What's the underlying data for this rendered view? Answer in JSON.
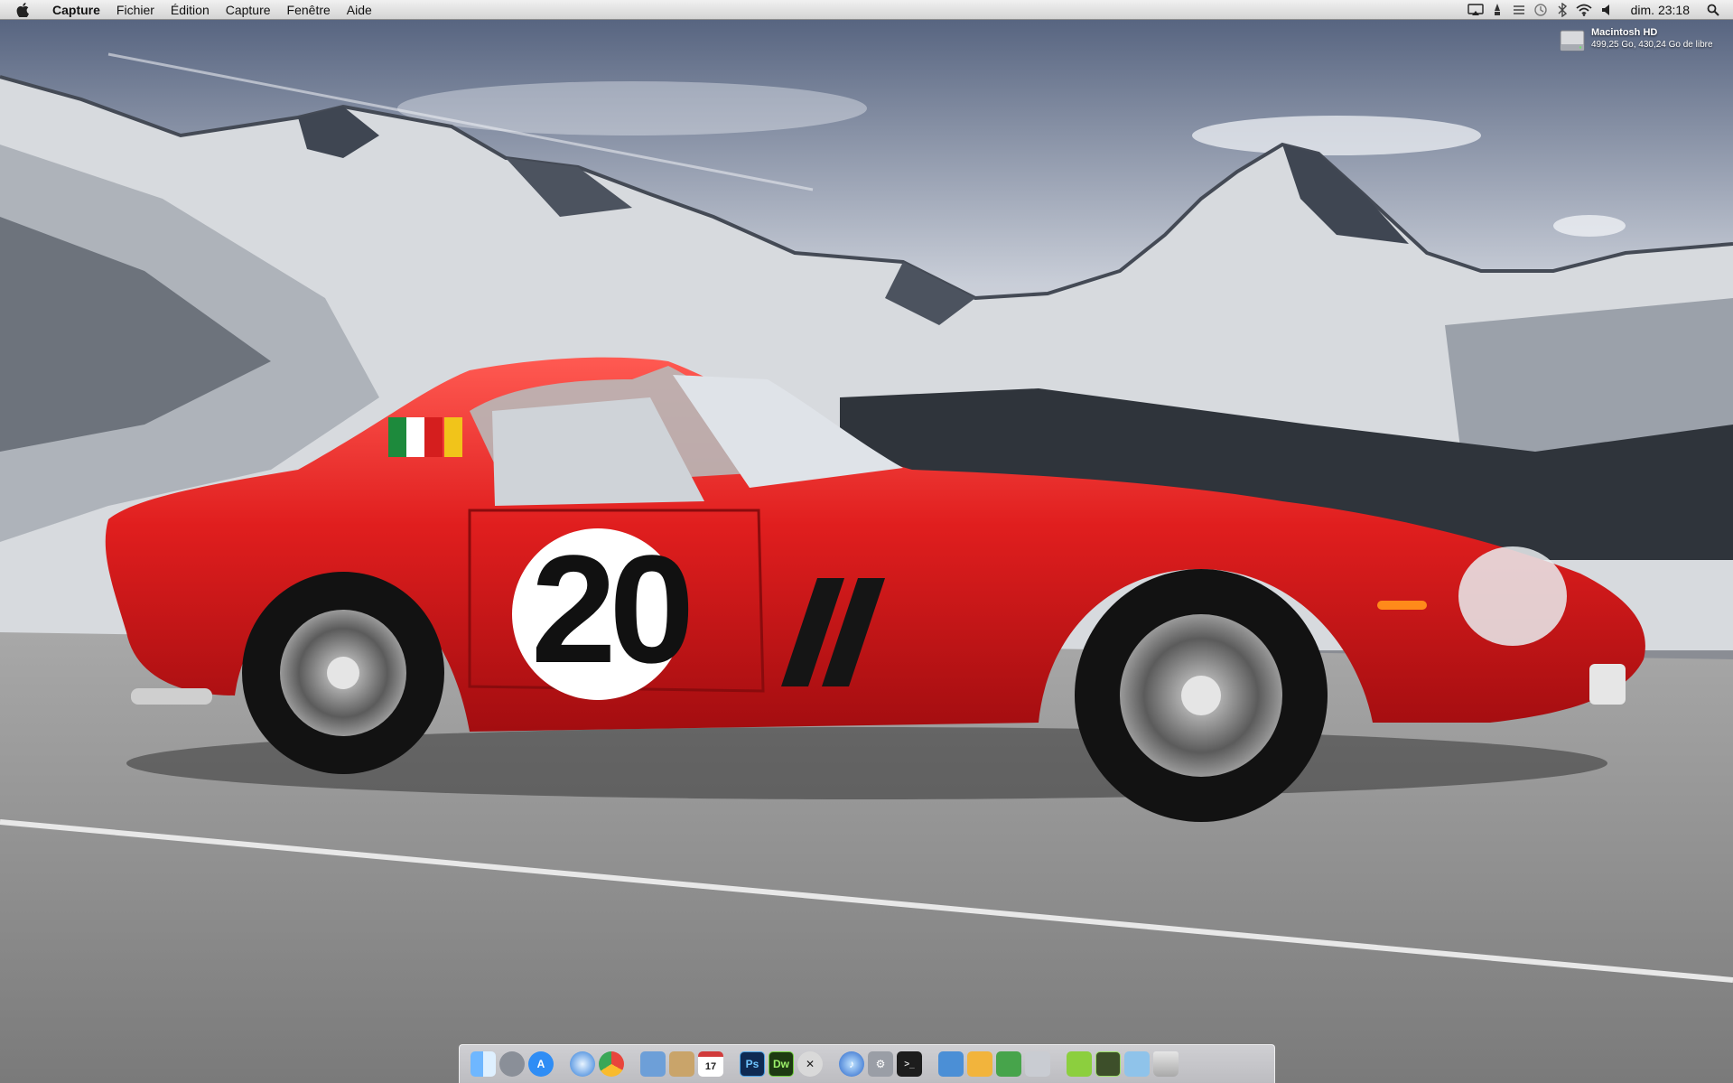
{
  "menubar": {
    "app_name": "Capture",
    "menus": [
      "Fichier",
      "Édition",
      "Capture",
      "Fenêtre",
      "Aide"
    ],
    "status_icons": [
      "airplay-icon",
      "alert-icon",
      "eject-icon",
      "time-machine-icon",
      "bluetooth-icon",
      "wifi-icon",
      "volume-icon"
    ],
    "clock": "dim. 23:18",
    "spotlight_icon": "search-icon"
  },
  "desktop": {
    "hd": {
      "name": "Macintosh HD",
      "info": "499,25 Go, 430,24 Go de libre"
    },
    "car_number": "20"
  },
  "dock": {
    "apps": [
      "finder-icon",
      "launchpad-icon",
      "app-store-icon",
      "safari-icon",
      "chrome-icon",
      "preview-icon",
      "contacts-icon",
      "calendar-icon",
      "photoshop-icon",
      "dreamweaver-icon",
      "x11-icon",
      "itunes-icon",
      "system-preferences-icon",
      "terminal-icon",
      "keynote-icon",
      "pages-icon",
      "numbers-icon",
      "coda-icon",
      "dashcode-icon",
      "pixelmator-icon",
      "finder-folder-icon",
      "trash-icon"
    ],
    "calendar_date": "17",
    "photoshop_label": "Ps",
    "dreamweaver_label": "Dw"
  }
}
